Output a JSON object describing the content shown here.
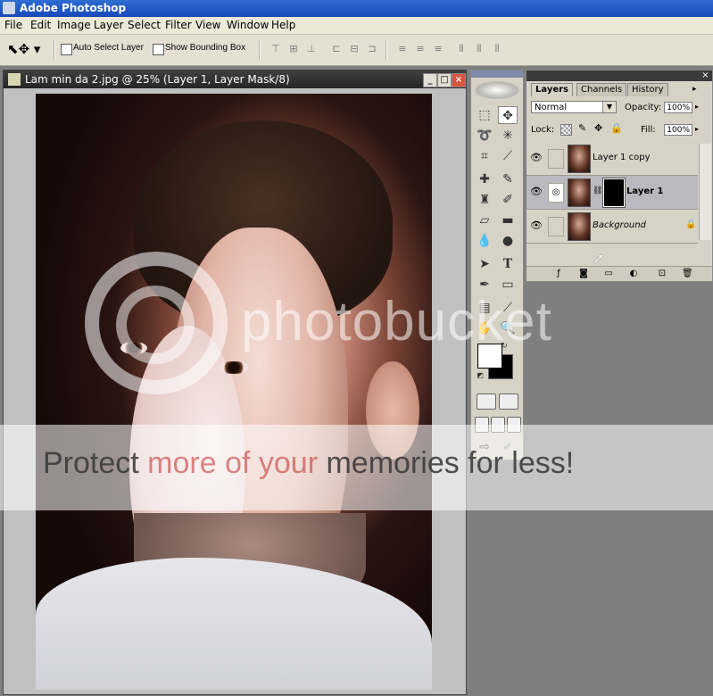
{
  "app": {
    "title": "Adobe Photoshop"
  },
  "menu": [
    "File",
    "Edit",
    "Image",
    "Layer",
    "Select",
    "Filter",
    "View",
    "Window",
    "Help"
  ],
  "options": {
    "auto_select_label": "Auto Select Layer",
    "bounding_box_label": "Show Bounding Box"
  },
  "document": {
    "title": "Lam min da  2.jpg @ 25% (Layer 1, Layer Mask/8)"
  },
  "layers_panel": {
    "tabs": [
      "Layers",
      "Channels",
      "History"
    ],
    "blend_mode": "Normal",
    "opacity_label": "Opacity:",
    "opacity_value": "100%",
    "lock_label": "Lock:",
    "fill_label": "Fill:",
    "fill_value": "100%",
    "layers": [
      {
        "name": "Layer 1 copy"
      },
      {
        "name": "Layer 1"
      },
      {
        "name": "Background"
      }
    ]
  },
  "watermark": {
    "logo_text": "photobucket",
    "part1": "Protect ",
    "part2": "more of your ",
    "part3": "memories for less!"
  },
  "colors": {
    "titlebar": "#1f55c4",
    "selected_layer": "#b9b9bf",
    "panel_bg": "#d6d3c6"
  }
}
